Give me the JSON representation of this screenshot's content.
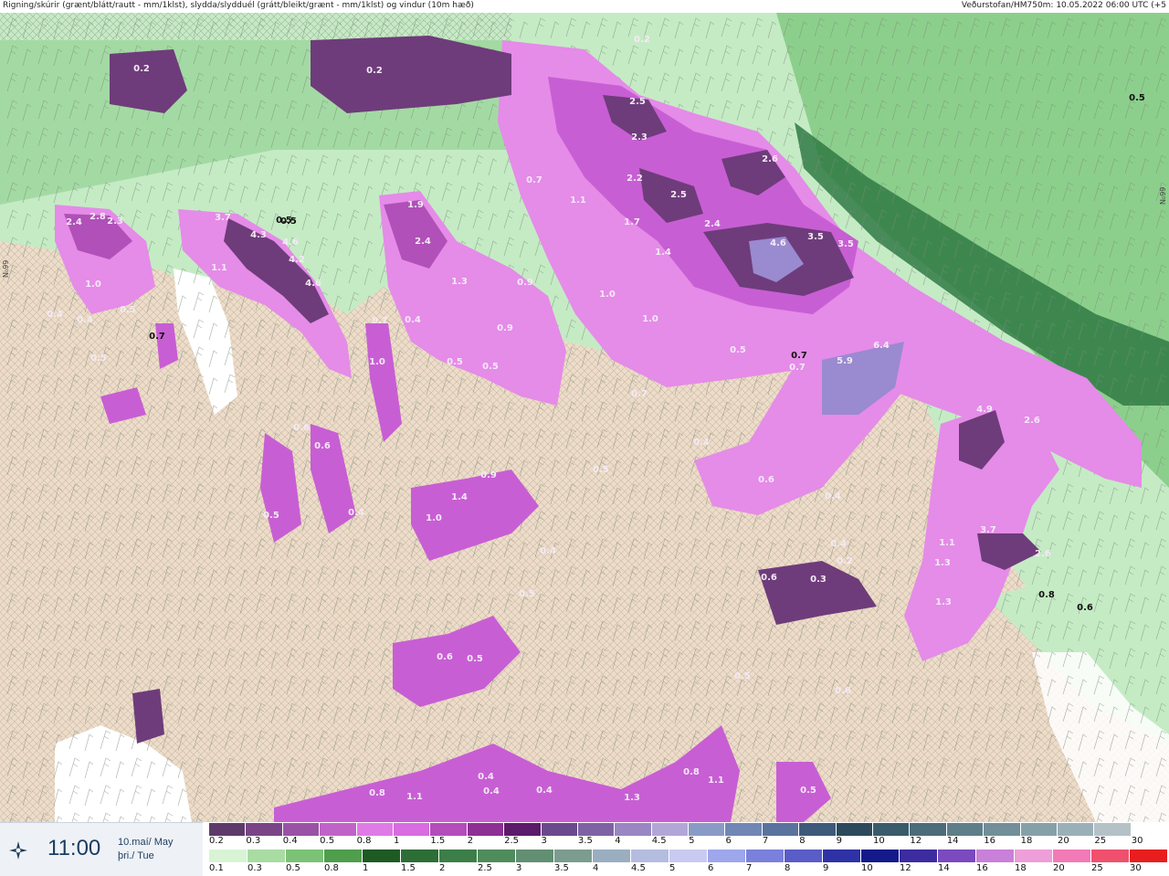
{
  "header": {
    "title_left": "Rigning/skúrir (grænt/blátt/rautt - mm/1klst), slydda/slydduél (grátt/bleikt/grænt - mm/1klst) og vindur (10m hæð)",
    "title_right": "Veðurstofan/HM750m: 10.05.2022 06:00 UTC (+5"
  },
  "footer": {
    "time": "11:00",
    "date_line1": "10.maí/ May",
    "date_line2": "þri./ Tue",
    "logo_icon": "vedurstofan-logo-icon"
  },
  "legend_top": {
    "labels": [
      "0.2",
      "0.3",
      "0.4",
      "0.5",
      "0.8",
      "1",
      "1.5",
      "2",
      "2.5",
      "3",
      "3.5",
      "4",
      "4.5",
      "5",
      "6",
      "7",
      "8",
      "9",
      "10",
      "12",
      "14",
      "16",
      "18",
      "20",
      "25",
      "30"
    ],
    "colors": [
      "#5e3a6a",
      "#7a4486",
      "#9a52a6",
      "#c063c8",
      "#e07ae6",
      "#d86ce0",
      "#b44cbc",
      "#8e2f96",
      "#5c1a6a",
      "#6a4a8c",
      "#7f62a4",
      "#9a86c2",
      "#b2a6d6",
      "#8a9ac6",
      "#7086b4",
      "#5a729e",
      "#3e5a7a",
      "#2c4a5c",
      "#3a5c6a",
      "#4c6c7a",
      "#5e7e8a",
      "#728e98",
      "#86a0a8",
      "#9ab0b8",
      "#b4c2c8",
      "#ffffff"
    ]
  },
  "legend_bottom": {
    "labels": [
      "0.1",
      "0.3",
      "0.5",
      "0.8",
      "1",
      "1.5",
      "2",
      "2.5",
      "3",
      "3.5",
      "4",
      "4.5",
      "5",
      "6",
      "7",
      "8",
      "9",
      "10",
      "12",
      "14",
      "16",
      "18",
      "20",
      "25",
      "30"
    ],
    "colors": [
      "#d8f4d4",
      "#a8dca2",
      "#7cc276",
      "#4e9e4c",
      "#1e5a24",
      "#2c6e36",
      "#3c7e48",
      "#4f8c5c",
      "#628f72",
      "#7c9c90",
      "#9aaec0",
      "#b4bce0",
      "#c8caf2",
      "#9ea6ec",
      "#7a80dc",
      "#5a5cc8",
      "#2e32a6",
      "#141a8a",
      "#3c2ca0",
      "#7a4abe",
      "#c880d8",
      "#ee9ed8",
      "#f27ab6",
      "#f0506e",
      "#e81e1e"
    ]
  },
  "map": {
    "latitude_label_left": "N₀99",
    "latitude_label_right": "N₀99",
    "colors": {
      "sea_light": "#c5ebc5",
      "sea_mid": "#8ccf8c",
      "sea_dark": "#2f7a44",
      "land": "#eddcc8",
      "ice": "#ffffff",
      "precip_light": "#e58be8",
      "precip_mid": "#c85ed4",
      "precip_dark": "#6e3c7a",
      "precip_max": "#9a8ad0"
    },
    "values": [
      {
        "t": "0.2",
        "tone": "light"
      },
      {
        "t": "0.2",
        "tone": "light"
      },
      {
        "t": "0.2",
        "tone": "light"
      },
      {
        "t": "2.5",
        "tone": "light"
      },
      {
        "t": "2.3",
        "tone": "light"
      },
      {
        "t": "2.2",
        "tone": "light"
      },
      {
        "t": "2.5",
        "tone": "light"
      },
      {
        "t": "2.6",
        "tone": "light"
      },
      {
        "t": "0.7",
        "tone": "light"
      },
      {
        "t": "1.1",
        "tone": "light"
      },
      {
        "t": "1.7",
        "tone": "light"
      },
      {
        "t": "2.4",
        "tone": "light"
      },
      {
        "t": "4.6",
        "tone": "light"
      },
      {
        "t": "3.5",
        "tone": "light"
      },
      {
        "t": "3.5",
        "tone": "light"
      },
      {
        "t": "1.4",
        "tone": "light"
      },
      {
        "t": "1.0",
        "tone": "light"
      },
      {
        "t": "1.0",
        "tone": "light"
      },
      {
        "t": "0.5",
        "tone": "light"
      },
      {
        "t": "0.7",
        "tone": "dark"
      },
      {
        "t": "1.9",
        "tone": "light"
      },
      {
        "t": "2.4",
        "tone": "light"
      },
      {
        "t": "1.3",
        "tone": "light"
      },
      {
        "t": "0.9",
        "tone": "light"
      },
      {
        "t": "0.9",
        "tone": "light"
      },
      {
        "t": "0.5",
        "tone": "light"
      },
      {
        "t": "0.5",
        "tone": "light"
      },
      {
        "t": "0.4",
        "tone": "light"
      },
      {
        "t": "1.0",
        "tone": "light"
      },
      {
        "t": "0.7",
        "tone": "light"
      },
      {
        "t": "3.7",
        "tone": "light"
      },
      {
        "t": "4.3",
        "tone": "light"
      },
      {
        "t": "4.6",
        "tone": "light"
      },
      {
        "t": "4.2",
        "tone": "light"
      },
      {
        "t": "4.6",
        "tone": "light"
      },
      {
        "t": "1.1",
        "tone": "light"
      },
      {
        "t": "0.5",
        "tone": "dark"
      },
      {
        "t": "2.4",
        "tone": "light"
      },
      {
        "t": "2.8",
        "tone": "light"
      },
      {
        "t": "2.3",
        "tone": "light"
      },
      {
        "t": "1.0",
        "tone": "light"
      },
      {
        "t": "0.4",
        "tone": "light"
      },
      {
        "t": "0.5",
        "tone": "light"
      },
      {
        "t": "0.4",
        "tone": "light"
      },
      {
        "t": "0.5",
        "tone": "light"
      },
      {
        "t": "0.6",
        "tone": "light"
      },
      {
        "t": "0.6",
        "tone": "light"
      },
      {
        "t": "0.5",
        "tone": "light"
      },
      {
        "t": "0.4",
        "tone": "light"
      },
      {
        "t": "0.9",
        "tone": "light"
      },
      {
        "t": "1.4",
        "tone": "light"
      },
      {
        "t": "1.0",
        "tone": "light"
      },
      {
        "t": "0.4",
        "tone": "light"
      },
      {
        "t": "0.5",
        "tone": "light"
      },
      {
        "t": "0.6",
        "tone": "light"
      },
      {
        "t": "0.4",
        "tone": "light"
      },
      {
        "t": "0.7",
        "tone": "light"
      },
      {
        "t": "5.9",
        "tone": "light"
      },
      {
        "t": "6.4",
        "tone": "light"
      },
      {
        "t": "0.4",
        "tone": "light"
      },
      {
        "t": "0.7",
        "tone": "light"
      },
      {
        "t": "4.9",
        "tone": "light"
      },
      {
        "t": "2.6",
        "tone": "light"
      },
      {
        "t": "3.7",
        "tone": "light"
      },
      {
        "t": "1.1",
        "tone": "light"
      },
      {
        "t": "1.3",
        "tone": "light"
      },
      {
        "t": "2.6",
        "tone": "light"
      },
      {
        "t": "1.3",
        "tone": "light"
      },
      {
        "t": "0.8",
        "tone": "dark"
      },
      {
        "t": "0.6",
        "tone": "dark"
      },
      {
        "t": "0.6",
        "tone": "light"
      },
      {
        "t": "0.3",
        "tone": "light"
      },
      {
        "t": "0.2",
        "tone": "light"
      },
      {
        "t": "0.6",
        "tone": "light"
      },
      {
        "t": "0.5",
        "tone": "light"
      },
      {
        "t": "0.5",
        "tone": "light"
      },
      {
        "t": "0.4",
        "tone": "light"
      },
      {
        "t": "0.4",
        "tone": "light"
      },
      {
        "t": "0.8",
        "tone": "light"
      },
      {
        "t": "1.1",
        "tone": "light"
      },
      {
        "t": "0.5",
        "tone": "light"
      },
      {
        "t": "0.6",
        "tone": "light"
      },
      {
        "t": "0.8",
        "tone": "light"
      },
      {
        "t": "1.1",
        "tone": "light"
      },
      {
        "t": "0.4",
        "tone": "light"
      },
      {
        "t": "0.4",
        "tone": "light"
      },
      {
        "t": "1.3",
        "tone": "light"
      },
      {
        "t": "0.5",
        "tone": "light"
      },
      {
        "t": "0.7",
        "tone": "dark"
      },
      {
        "t": "0.5",
        "tone": "dark"
      },
      {
        "t": "0.5",
        "tone": "dark"
      }
    ]
  }
}
